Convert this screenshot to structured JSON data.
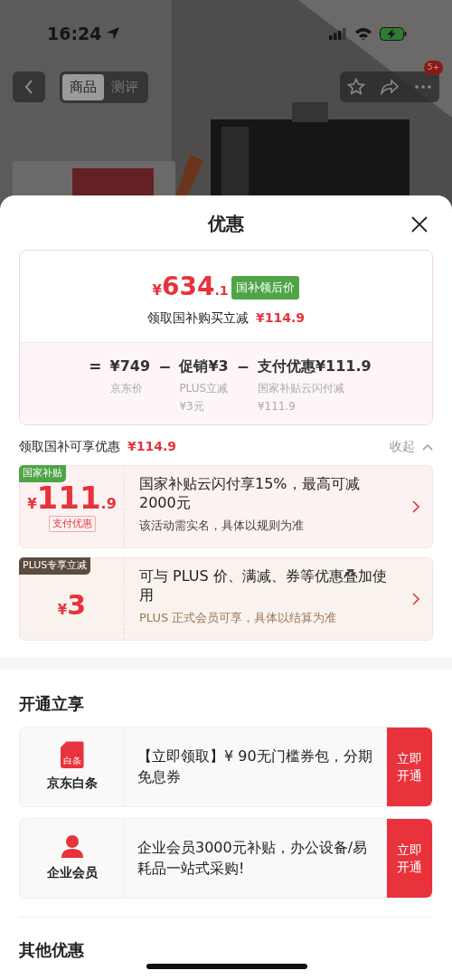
{
  "status_bar": {
    "time": "16:24"
  },
  "product_header": {
    "tabs": [
      {
        "label": "商品",
        "selected": true
      },
      {
        "label": "测评",
        "selected": false
      }
    ],
    "more_badge": "5+"
  },
  "sheet": {
    "title": "优惠",
    "price_summary": {
      "currency": "¥",
      "price_main": "634",
      "price_decimal": ".1",
      "tag": "国补领后价",
      "saving_label": "领取国补购买立减",
      "saving_amount": "¥114.9",
      "formula": [
        {
          "operator": "=",
          "amount": "¥749",
          "notes": [
            "京东价"
          ]
        },
        {
          "operator": "−",
          "amount": "促销¥3",
          "notes": [
            "PLUS立减",
            "¥3元"
          ]
        },
        {
          "operator": "−",
          "amount": "支付优惠¥111.9",
          "notes": [
            "国家补贴云闪付减",
            "¥111.9"
          ]
        }
      ]
    },
    "offers_header": {
      "label": "领取国补可享优惠",
      "amount": "¥114.9",
      "toggle": "收起",
      "expanded": true
    },
    "offers": [
      {
        "kind": "subsidy",
        "tag": "国家补贴",
        "currency": "¥",
        "amount_main": "111",
        "amount_decimal": ".9",
        "sub_tag": "支付优惠",
        "title": "国家补贴云闪付享15%，最高可减2000元",
        "note": "该活动需实名，具体以规则为准"
      },
      {
        "kind": "plus",
        "tag": "PLUS专享立减",
        "currency": "¥",
        "amount_main": "3",
        "title": "可与 PLUS 价、满减、券等优惠叠加使用",
        "note": "PLUS 正式会员可享，具体以结算为准"
      }
    ],
    "open_section": {
      "title": "开通立享",
      "items": [
        {
          "kind": "baitiao",
          "name": "京东白条",
          "icon_text": "白条",
          "description": "【立即领取】¥ 90无门槛券包，分期免息券",
          "button": "立即开通"
        },
        {
          "kind": "enterprise",
          "name": "企业会员",
          "description": "企业会员3000元补贴，办公设备/易耗品一站式采购!",
          "button": "立即开通"
        }
      ]
    },
    "other_section": {
      "title": "其他优惠"
    }
  }
}
